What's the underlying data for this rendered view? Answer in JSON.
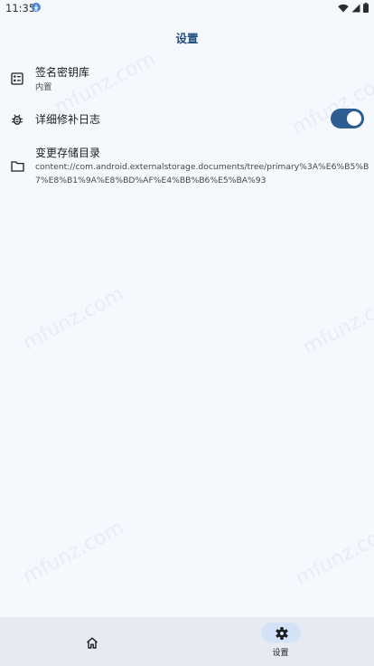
{
  "status_bar": {
    "time": "11:35"
  },
  "app_bar": {
    "title": "设置"
  },
  "settings": [
    {
      "icon": "keystore-list-icon",
      "title": "签名密钥库",
      "subtitle": "内置"
    },
    {
      "icon": "bug-icon",
      "title": "详细修补日志",
      "toggle_on": true
    },
    {
      "icon": "folder-icon",
      "title": "变更存储目录",
      "subtitle": "content://com.android.externalstorage.documents/tree/primary%3A%E6%B5%B7%E8%B1%9A%E8%BD%AF%E4%BB%B6%E5%BA%93"
    }
  ],
  "watermark": "mfunz.com",
  "bottom_nav": {
    "items": [
      {
        "icon": "home-icon",
        "label": ""
      },
      {
        "icon": "gear-icon",
        "label": "设置",
        "selected": true
      }
    ]
  },
  "colors": {
    "background": "#f5f8fd",
    "accent": "#2e5e91",
    "title": "#1f4e7e",
    "nav_background": "#e6ebf3",
    "nav_pill": "#d3e2f6"
  }
}
